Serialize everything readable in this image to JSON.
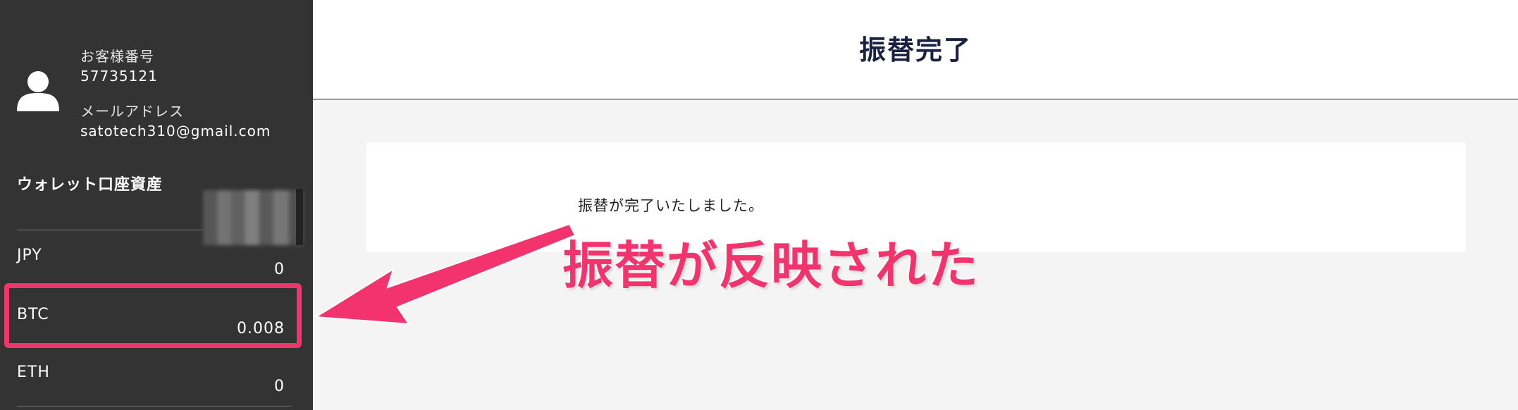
{
  "account": {
    "customer_number_label": "お客様番号",
    "customer_number": "57735121",
    "email_label": "メールアドレス",
    "email": "satotech310@gmail.com"
  },
  "wallet": {
    "title": "ウォレット口座資産",
    "currencies": [
      {
        "name": "JPY",
        "value": "0"
      },
      {
        "name": "BTC",
        "value": "0.008"
      },
      {
        "name": "ETH",
        "value": "0"
      }
    ]
  },
  "header": {
    "title": "振替完了"
  },
  "main": {
    "message": "振替が完了いたしました。"
  },
  "annotation": {
    "text": "振替が反映された"
  },
  "colors": {
    "sidebar_bg": "#333333",
    "accent_pink": "#f2336e",
    "title_navy": "#1b2140",
    "content_bg": "#f4f4f4"
  }
}
